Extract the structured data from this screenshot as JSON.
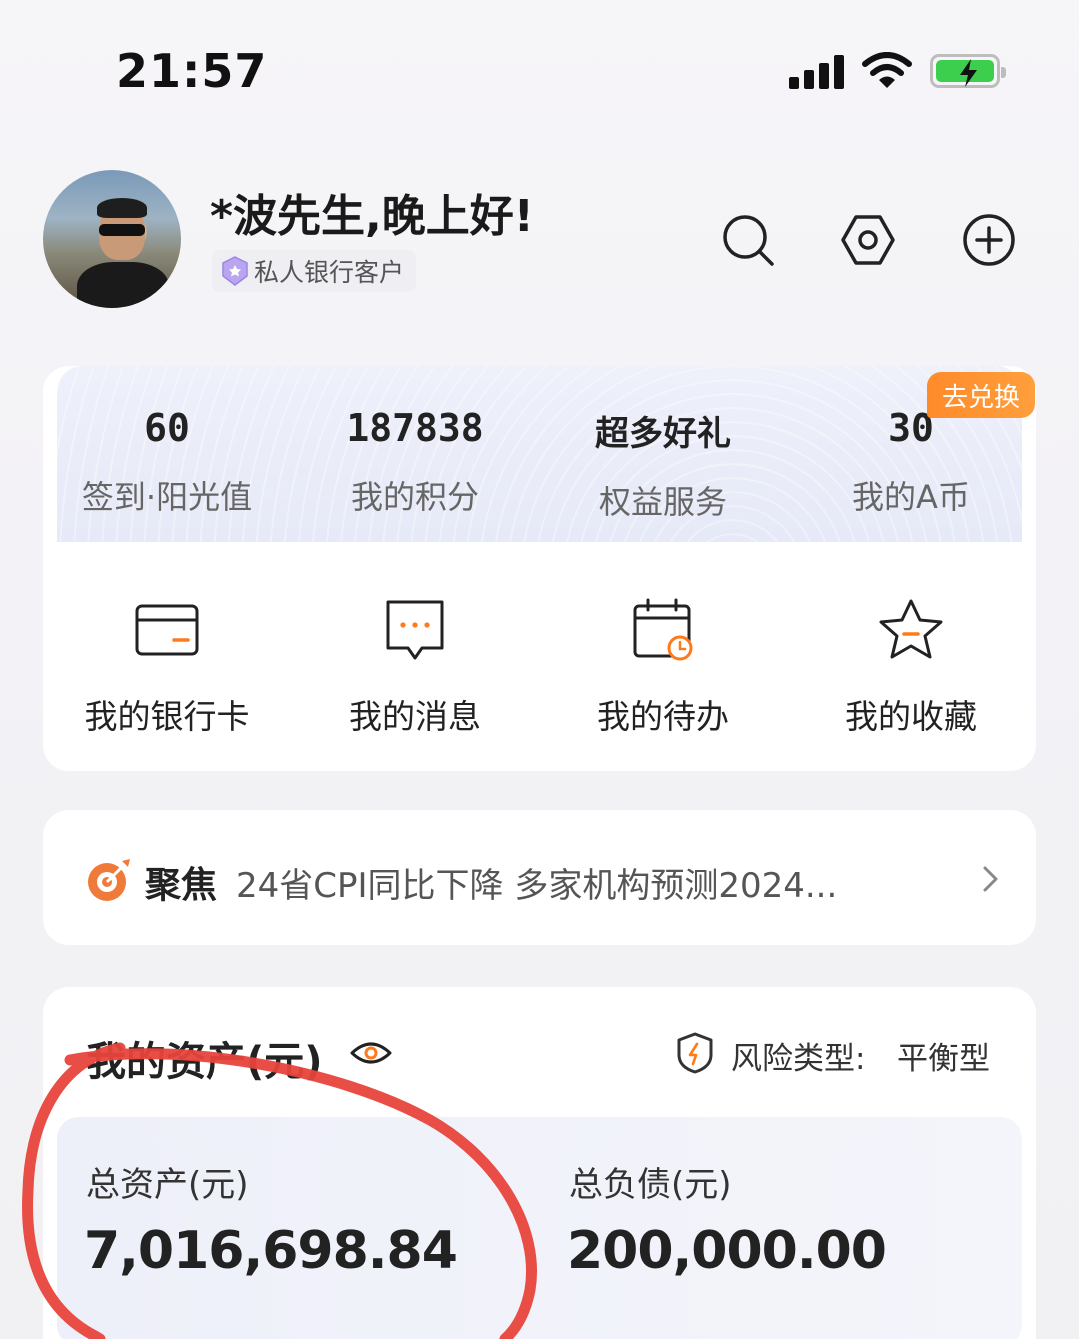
{
  "status_bar": {
    "time": "21:57"
  },
  "header": {
    "greeting": "*波先生,晚上好!",
    "tier": "私人银行客户",
    "icons": [
      "search-icon",
      "settings-icon",
      "add-icon"
    ]
  },
  "points": {
    "exchange_badge": "去兑换",
    "items": [
      {
        "value": "60",
        "label": "签到·阳光值"
      },
      {
        "value": "187838",
        "label": "我的积分"
      },
      {
        "value": "超多好礼",
        "label": "权益服务"
      },
      {
        "value": "30",
        "label": "我的A币"
      }
    ]
  },
  "quick_actions": [
    {
      "icon": "bank-card-icon",
      "label": "我的银行卡"
    },
    {
      "icon": "message-icon",
      "label": "我的消息"
    },
    {
      "icon": "calendar-clock-icon",
      "label": "我的待办"
    },
    {
      "icon": "star-icon",
      "label": "我的收藏"
    }
  ],
  "news": {
    "tag": "聚焦",
    "text": "24省CPI同比下降 多家机构预测2024..."
  },
  "assets": {
    "title": "我的资产(元)",
    "risk_label": "风险类型:",
    "risk_value": "平衡型",
    "total_assets_label": "总资产(元)",
    "total_assets_value": "7,016,698.84",
    "total_liabilities_label": "总负债(元)",
    "total_liabilities_value": "200,000.00"
  },
  "colors": {
    "accent_orange": "#ff8a2a",
    "annotation_red": "#e8453c",
    "battery_green": "#3ccf4e"
  }
}
